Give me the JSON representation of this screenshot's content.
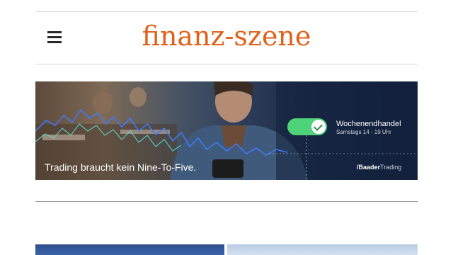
{
  "header": {
    "logo_text": "finanz-szene",
    "menu_icon": "hamburger-menu-icon"
  },
  "banner": {
    "headline": "Trading braucht kein Nine-To-Five.",
    "toggle_label": "Wochenendhandel",
    "toggle_sublabel": "Samstags 14 - 19 Uhr",
    "toggle_state": "on",
    "brand_prefix": "/",
    "brand_bold": "Baader",
    "brand_thin": "Trading"
  },
  "colors": {
    "logo": "#e2611a",
    "toggle_on": "#4fd37a"
  }
}
